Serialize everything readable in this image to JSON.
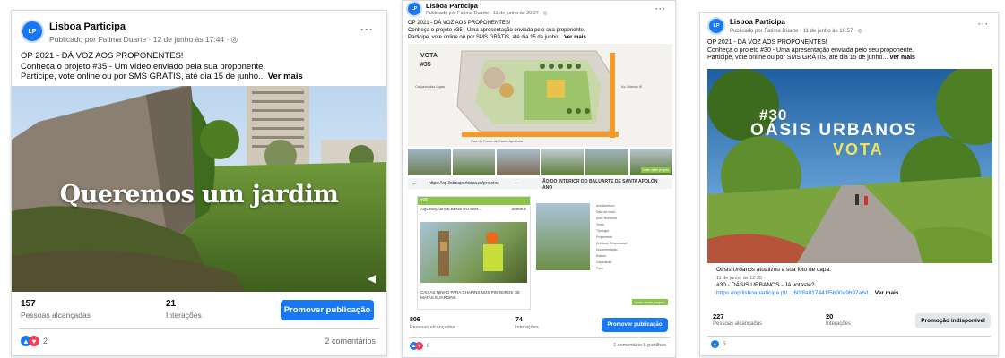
{
  "posts": [
    {
      "page_name": "Lisboa Participa",
      "meta": "Publicado por Fatima Duarte · 12 de junho às 17:44 ·",
      "text_line1": "OP 2021 - DÁ VOZ AOS PROPONENTES!",
      "text_line2": "Conheça o projeto #35 - Um vídeo enviado pela sua proponente.",
      "text_line3": "Participe, vote online ou por SMS GRÁTIS, até dia 15 de junho...",
      "see_more": "Ver mais",
      "image_caption": "Queremos um jardim",
      "reach_value": "157",
      "reach_label": "Pessoas alcançadas",
      "interactions_value": "21",
      "interactions_label": "Interações",
      "action_button": "Promover publicação",
      "reactions_count": "2",
      "comments": "2 comentários"
    },
    {
      "page_name": "Lisboa Participa",
      "meta": "Publicado por Fatima Duarte · 11 de junho às 20:27 ·",
      "text_line1": "OP 2021 - DÁ VOZ AOS PROPONENTES!",
      "text_line2": "Conheça o projeto #35 - Uma apresentação enviada pelo sua proponente.",
      "text_line3": "Participe, vote online ou por SMS GRÁTIS, até dia 15 de junho...",
      "see_more": "Ver mais",
      "vota_label": "VOTA",
      "vota_number": "#35",
      "map_label_left": "Calçada dos Lojas",
      "map_label_right": "Av. Afonso III",
      "map_label_bottom": "Rua do Forno de Santo Apolónia",
      "map_button": "Votar neste projeto",
      "browser_url": "https://op.lisboaparticipa.pt/projetos",
      "browser_title_1": "ÃO DO INTERIOR DO BALUARTE DE SANTA APOLÓN",
      "browser_title_2": "ANO",
      "card_tag": "#35",
      "card_heading": "AQUISIÇÃO DE BENS OU SER...",
      "card_price": "20000 €",
      "card_caption": "CAIXAS NINHO PARA CHAPINS NOS PINHEIROS DE MATAS E JARDINS",
      "detail_rows": [
        "Ano Abertura",
        "Data de início",
        "Área Territorial",
        "Tema",
        "Tipologia",
        "Proponente",
        "Entidade Responsável",
        "Documentação",
        "Estado",
        "Orçamento",
        "Fase"
      ],
      "detail_button": "Votar neste projeto",
      "reach_value": "806",
      "reach_label": "Pessoas alcançadas",
      "interactions_value": "74",
      "interactions_label": "Interações",
      "action_button": "Promover publicação",
      "reactions_count": "6",
      "comments": "1 comentário  5 partilhas"
    },
    {
      "page_name": "Lisboa Participa",
      "meta": "Publicado por Fatima Duarte · 11 de junho às 16:57 ·",
      "text_line1": "OP 2021 - DÁ VOZ AOS PROPONENTES!",
      "text_line2": "Conheça o projeto #30 - Uma apresentação enviada pelo seu proponente.",
      "text_line3": "Participe, vote online ou por SMS GRÁTIS, até dia 15 de junho...",
      "see_more": "Ver mais",
      "image_num": "#30",
      "image_title": "OÁSIS URBANOS",
      "image_vota": "VOTA",
      "shared_title": "Oásis Urbanos atualizou a sua foto de capa.",
      "shared_meta": "11 de junho às 12:35 ·",
      "shared_text": "#30 - OÁSIS URBANOS - Já votaste?",
      "shared_link": "https://op.lisboaparticipa.pt/.../60f8a817441f5b00a9b97a6d...",
      "shared_more": "Ver mais",
      "reach_value": "227",
      "reach_label": "Pessoas alcançadas",
      "interactions_value": "20",
      "interactions_label": "Interações",
      "action_button": "Promoção indisponível",
      "reactions_count": "5"
    }
  ],
  "colors": {
    "facebook_blue": "#1877f2",
    "green_banner": "#8bc34a",
    "vota_yellow": "#f2e35b"
  },
  "icons": [
    "globe-icon",
    "more-options-icon",
    "like-reaction-icon",
    "love-reaction-icon",
    "speaker-icon",
    "back-arrow-icon"
  ]
}
